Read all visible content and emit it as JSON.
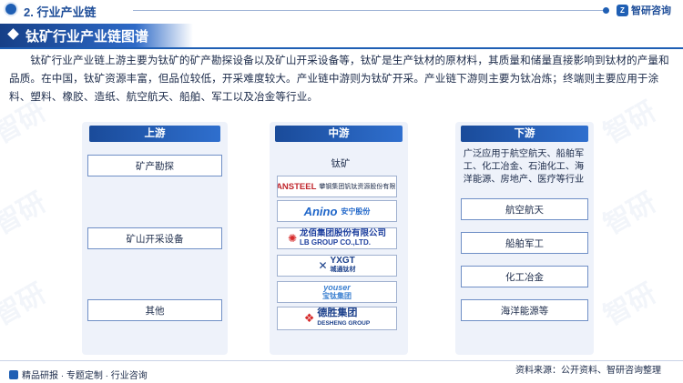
{
  "header": {
    "section": "2. 行业产业链",
    "logo_text": "智研咨询",
    "logo_mark": "Z"
  },
  "title": "钛矿行业产业链图谱",
  "intro": "钛矿行业产业链上游主要为钛矿的矿产勘探设备以及矿山开采设备等，钛矿是生产钛材的原材料，其质量和储量直接影响到钛材的产量和品质。在中国，钛矿资源丰富，但品位较低，开采难度较大。产业链中游则为钛矿开采。产业链下游则主要为钛冶炼；终端则主要应用于涂料、塑料、橡胶、造纸、航空航天、船舶、军工以及冶金等行业。",
  "upstream": {
    "label": "上游",
    "items": [
      "矿产勘探",
      "矿山开采设备",
      "其他"
    ]
  },
  "midstream": {
    "label": "中游",
    "subtitle": "钛矿",
    "companies": [
      {
        "name": "攀钢集团钒钛资源股份有限公司",
        "sub": "ANSTEEL",
        "color": "#c0262d"
      },
      {
        "name": "Anino",
        "sub": "安宁股份",
        "color": "#1f66c9"
      },
      {
        "name": "龙佰集团股份有限公司",
        "sub": "LB GROUP CO.,LTD.",
        "color": "#1d3f9e"
      },
      {
        "name": "YXGT",
        "sub": "城通钛材",
        "color": "#1a3f8a"
      },
      {
        "name": "youser",
        "sub": "宝钛集团",
        "color": "#3a7fd0"
      },
      {
        "name": "德胜集团",
        "sub": "DESHENG GROUP",
        "color": "#1a3f8a"
      }
    ]
  },
  "downstream": {
    "label": "下游",
    "description": "广泛应用于航空航天、船舶军工、化工冶金、石油化工、海洋能源、房地产、医疗等行业",
    "items": [
      "航空航天",
      "船舶军工",
      "化工冶金",
      "海洋能源等"
    ]
  },
  "footer": {
    "left": "精品研报 · 专题定制 · 行业咨询",
    "right": "资料来源：公开资料、智研咨询整理"
  },
  "colors": {
    "primary": "#1f5fb4",
    "panel": "#eef2fa",
    "border": "#6f8fc6"
  }
}
